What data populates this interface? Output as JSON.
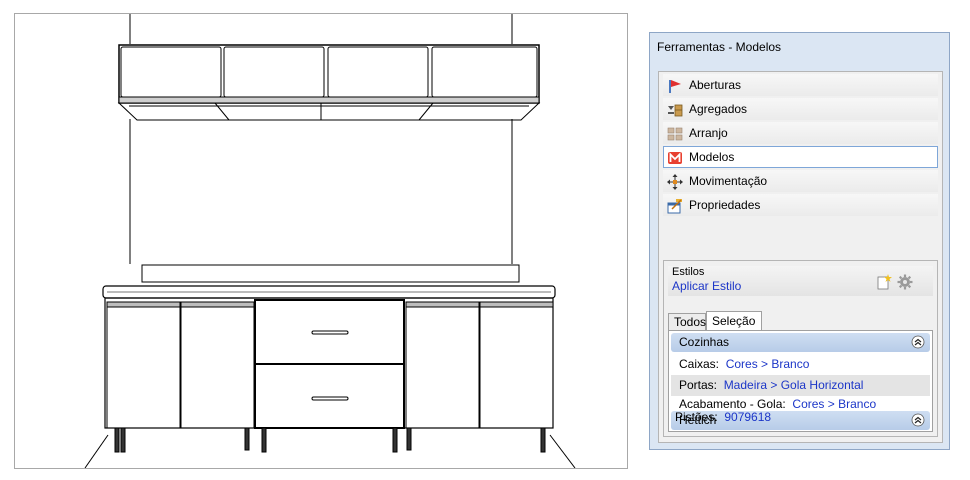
{
  "panel": {
    "title": "Ferramentas - Modelos",
    "tools": [
      {
        "label": "Aberturas",
        "icon": "flag-icon"
      },
      {
        "label": "Agregados",
        "icon": "aggregates-icon"
      },
      {
        "label": "Arranjo",
        "icon": "arrangement-icon"
      },
      {
        "label": "Modelos",
        "icon": "models-icon",
        "selected": true
      },
      {
        "label": "Movimentação",
        "icon": "move-arrows-icon"
      },
      {
        "label": "Propriedades",
        "icon": "properties-icon"
      }
    ]
  },
  "styles": {
    "title": "Estilos",
    "apply_label": "Aplicar Estilo",
    "tabs": [
      "Todos",
      "Seleção"
    ],
    "active_tab": "Seleção",
    "groups": [
      {
        "title": "Cozinhas",
        "rows": [
          {
            "key": "Caixas:",
            "value": "Cores > Branco"
          },
          {
            "key": "Portas:",
            "value": "Madeira > Gola Horizontal"
          },
          {
            "key": "Acabamento - Gola:",
            "value": "Cores > Branco"
          }
        ]
      },
      {
        "title": "Hettich",
        "rows": [
          {
            "key": "Pistões:",
            "value": "9079618"
          }
        ]
      }
    ]
  },
  "colors": {
    "panel_bg": "#dbe6f3",
    "link_blue": "#1c36c8",
    "group_header": "#c3d5ee",
    "selection_border": "#7ea6d8"
  }
}
